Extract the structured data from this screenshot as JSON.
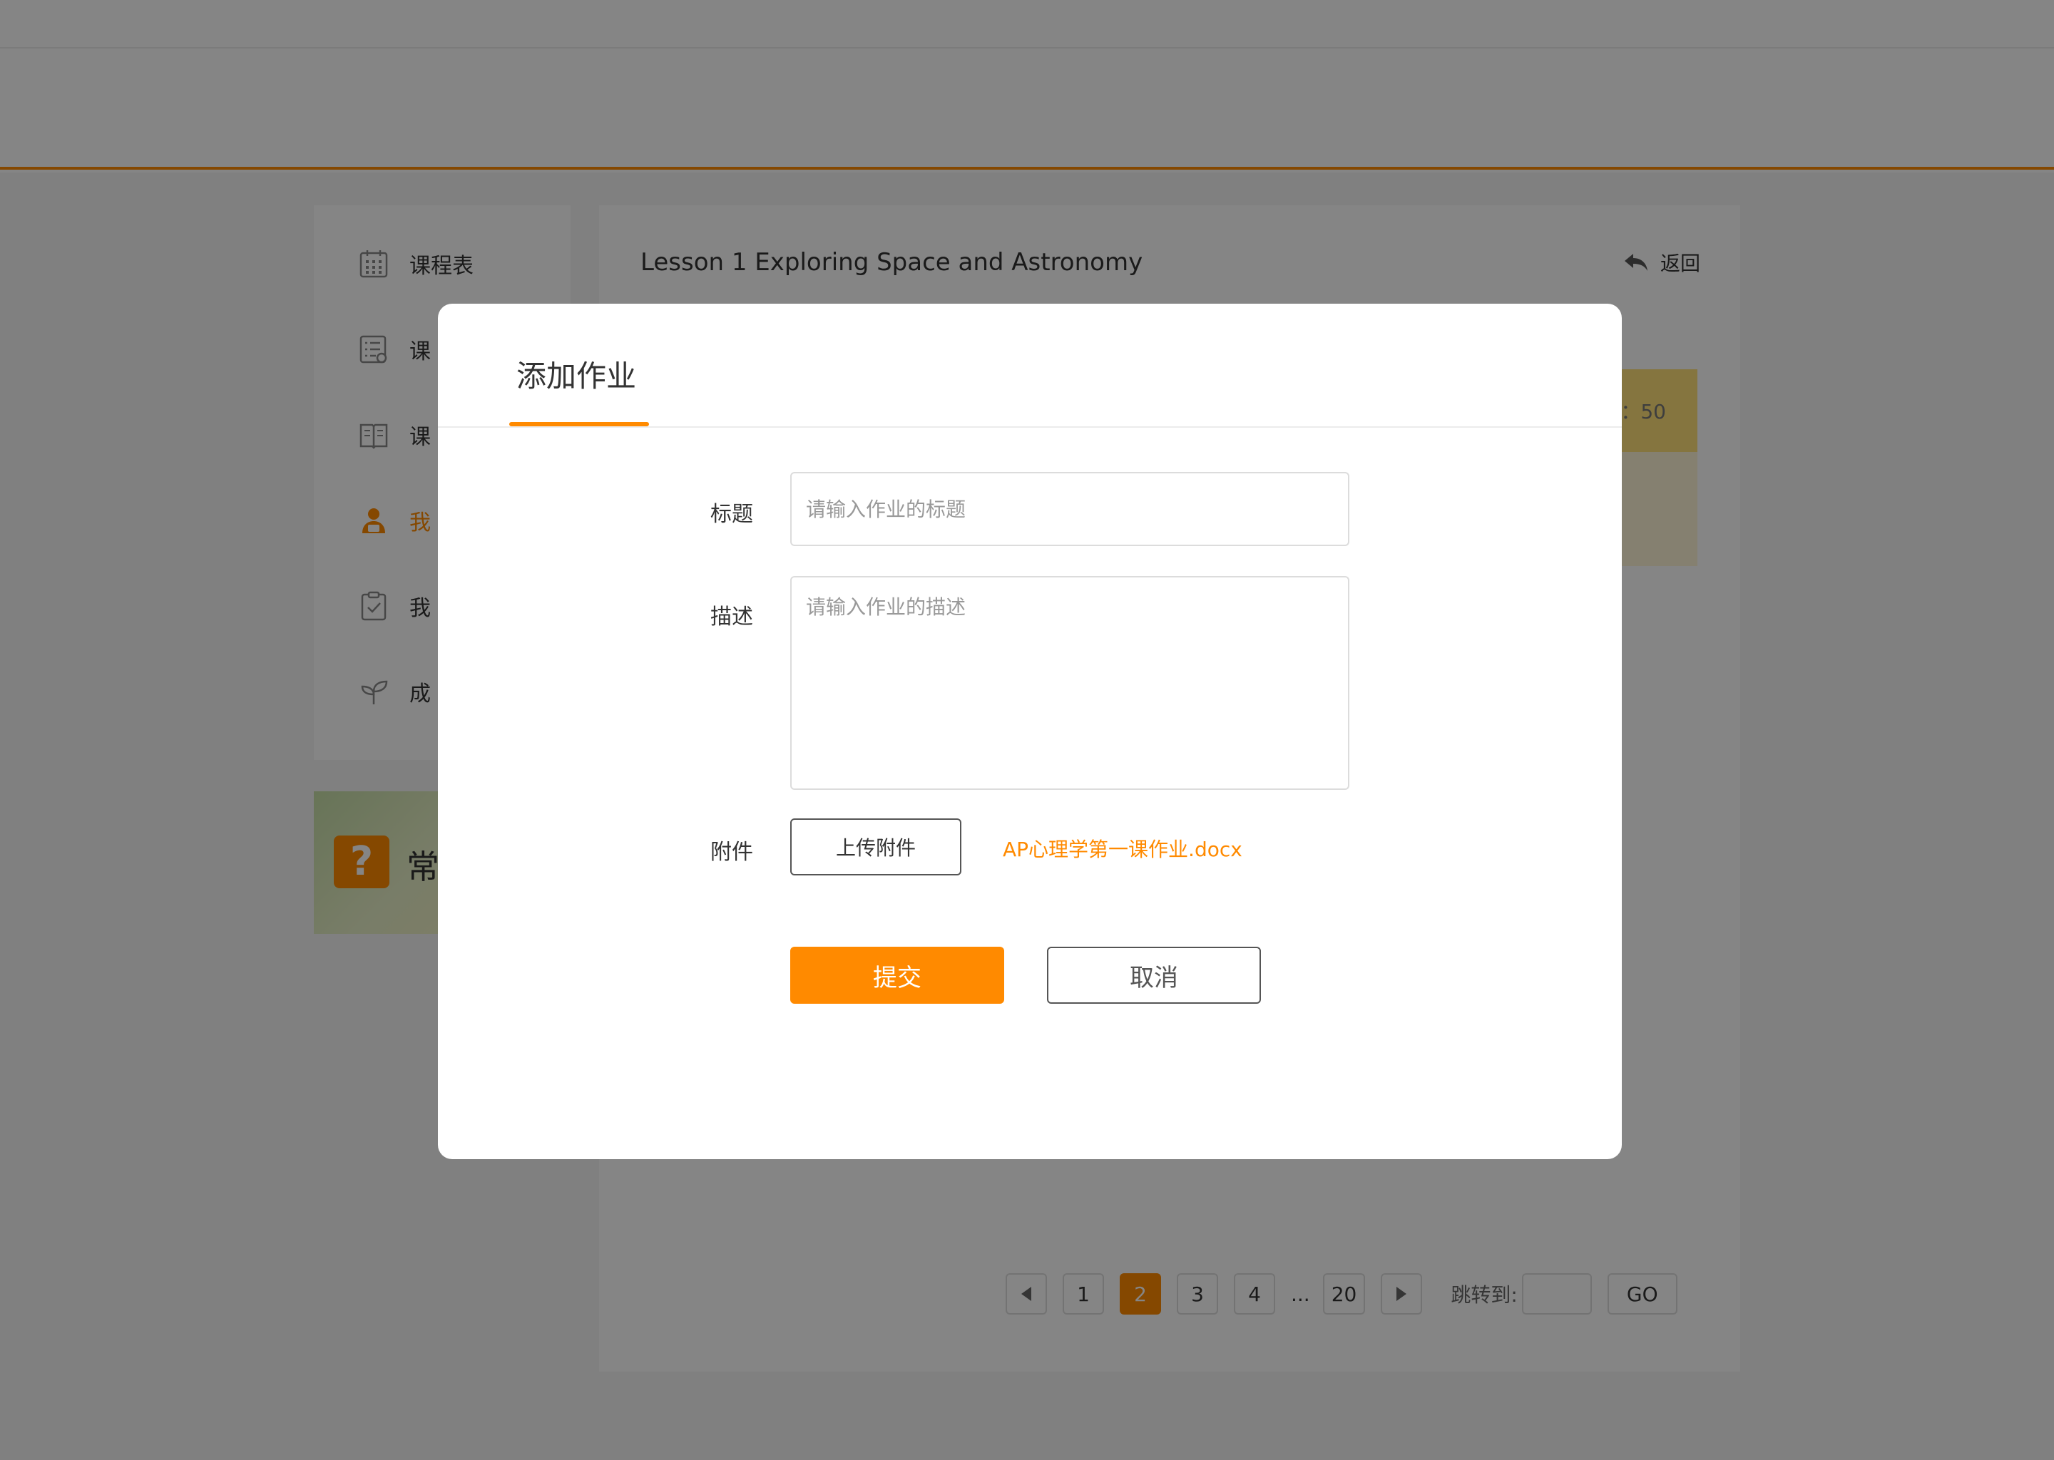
{
  "sidebar": {
    "items": [
      {
        "label": "课程表",
        "icon": "calendar-icon"
      },
      {
        "label": "课",
        "icon": "list-icon"
      },
      {
        "label": "课",
        "icon": "book-icon"
      },
      {
        "label": "我",
        "icon": "student-icon",
        "active": true
      },
      {
        "label": "我",
        "icon": "clipboard-check-icon"
      },
      {
        "label": "成",
        "icon": "sprout-icon"
      }
    ],
    "faq_text": "常",
    "faq_badge": "?"
  },
  "content": {
    "lesson_title": "Lesson 1 Exploring Space and Astronomy",
    "back_label": "返回",
    "info_value": "：50"
  },
  "pager": {
    "pages": [
      "1",
      "2",
      "3",
      "4",
      "...",
      "20"
    ],
    "active": "2",
    "jump_label": "跳转到:",
    "go_label": "GO"
  },
  "modal": {
    "title": "添加作业",
    "title_label": "标题",
    "title_placeholder": "请输入作业的标题",
    "desc_label": "描述",
    "desc_placeholder": "请输入作业的描述",
    "attach_label": "附件",
    "upload_label": "上传附件",
    "attached_file": "AP心理学第一课作业.docx",
    "submit_label": "提交",
    "cancel_label": "取消"
  },
  "colors": {
    "accent": "#ff8a00",
    "info_band": "#ffe17a"
  }
}
